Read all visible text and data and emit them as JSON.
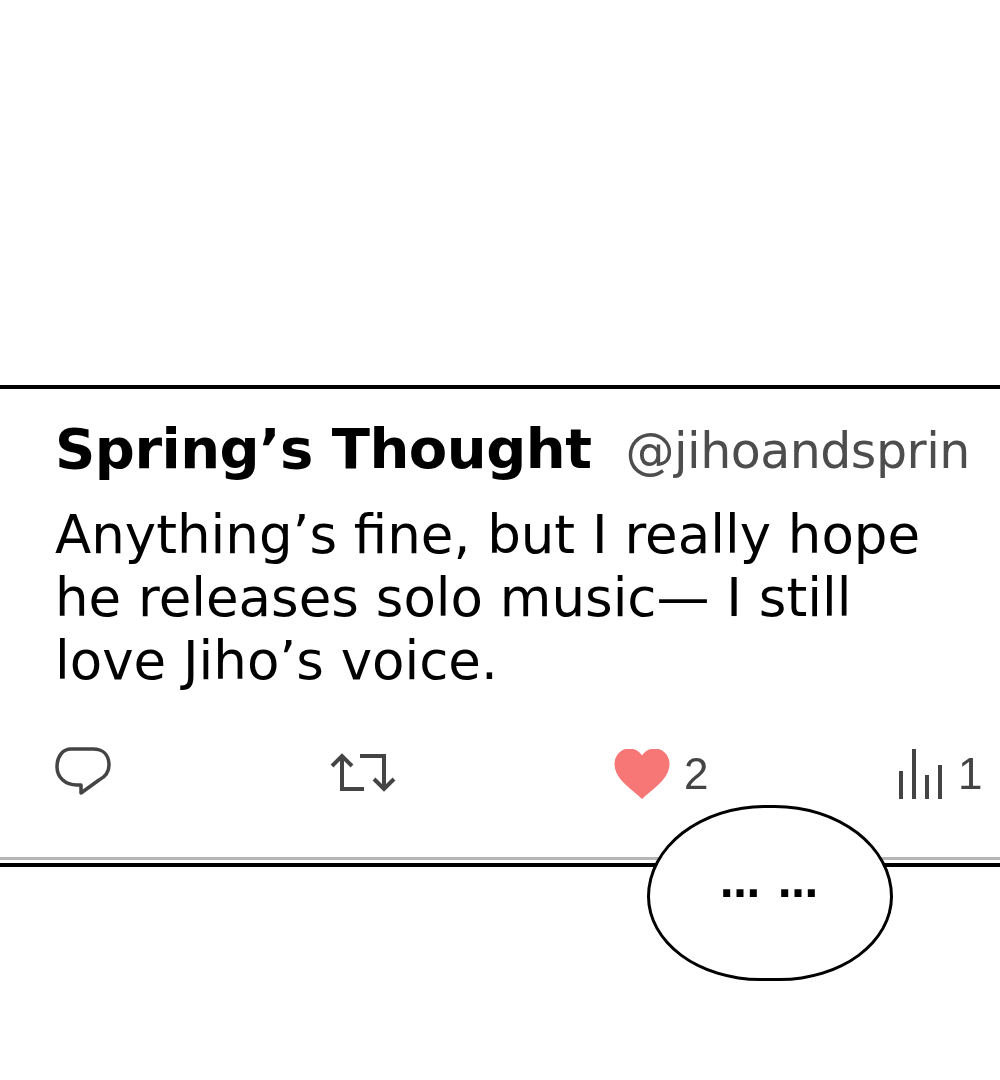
{
  "post": {
    "author": {
      "name": "Spring’s Thought",
      "handle": "@jihoandsprin"
    },
    "text": "Anything’s fine, but I really hope he releases solo music— I still love Jiho’s voice.",
    "actions": [
      {
        "kind": "reply"
      },
      {
        "kind": "repost"
      },
      {
        "kind": "like",
        "liked": true,
        "count": "2"
      },
      {
        "kind": "views",
        "count": "1"
      }
    ]
  },
  "speech_bubble": {
    "text": "… …"
  }
}
